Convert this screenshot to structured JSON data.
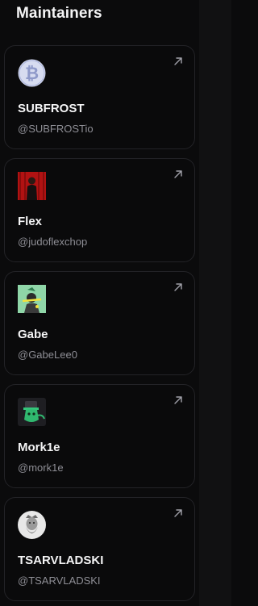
{
  "section": {
    "title": "Maintainers"
  },
  "maintainers": [
    {
      "name": "SUBFROST",
      "handle": "@SUBFROSTio",
      "avatar": "bitcoin-logo-icon"
    },
    {
      "name": "Flex",
      "handle": "@judoflexchop",
      "avatar": "flex-avatar"
    },
    {
      "name": "Gabe",
      "handle": "@GabeLee0",
      "avatar": "gabe-avatar"
    },
    {
      "name": "Mork1e",
      "handle": "@mork1e",
      "avatar": "mork1e-avatar"
    },
    {
      "name": "TSARVLADSKI",
      "handle": "@TSARVLADSKI",
      "avatar": "tsarvladski-avatar"
    }
  ],
  "colors": {
    "background": "#0b0b0c",
    "card_border": "#232327",
    "text_primary": "#f4f4f5",
    "text_secondary": "#8e8e95",
    "arrow": "#a1a1aa"
  }
}
